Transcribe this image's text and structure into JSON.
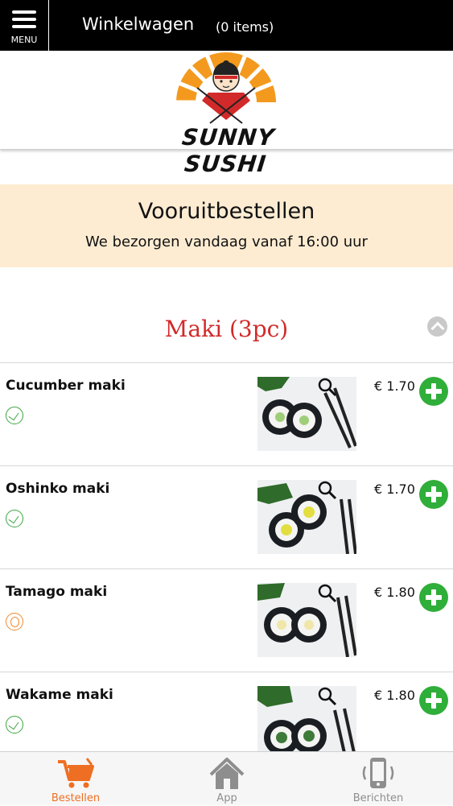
{
  "header": {
    "menu_label": "MENU",
    "title": "Winkelwagen",
    "item_count": "(0 items)"
  },
  "brand": {
    "logo_text": "SUNNY SUSHI",
    "colors": {
      "orange": "#f39a1e",
      "red": "#d22a2a"
    }
  },
  "banner": {
    "heading": "Vooruitbestellen",
    "subtext": "We bezorgen vandaag vanaf 16:00 uur"
  },
  "category": {
    "title": "Maki (3pc)",
    "collapse_icon": "chevron-up-icon"
  },
  "items": [
    {
      "name": "Cucumber maki",
      "price": "€ 1.70",
      "diet_icon": "vegetarian-icon"
    },
    {
      "name": "Oshinko maki",
      "price": "€ 1.70",
      "diet_icon": "vegetarian-icon"
    },
    {
      "name": "Tamago maki",
      "price": "€ 1.80",
      "diet_icon": "egg-icon"
    },
    {
      "name": "Wakame maki",
      "price": "€ 1.80",
      "diet_icon": "vegetarian-icon"
    }
  ],
  "tabbar": {
    "tabs": [
      {
        "label": "Bestellen",
        "icon": "cart-icon",
        "active": true
      },
      {
        "label": "App",
        "icon": "home-icon",
        "active": false
      },
      {
        "label": "Berichten",
        "icon": "phone-icon",
        "active": false
      }
    ],
    "active_color": "#ee6f23"
  }
}
